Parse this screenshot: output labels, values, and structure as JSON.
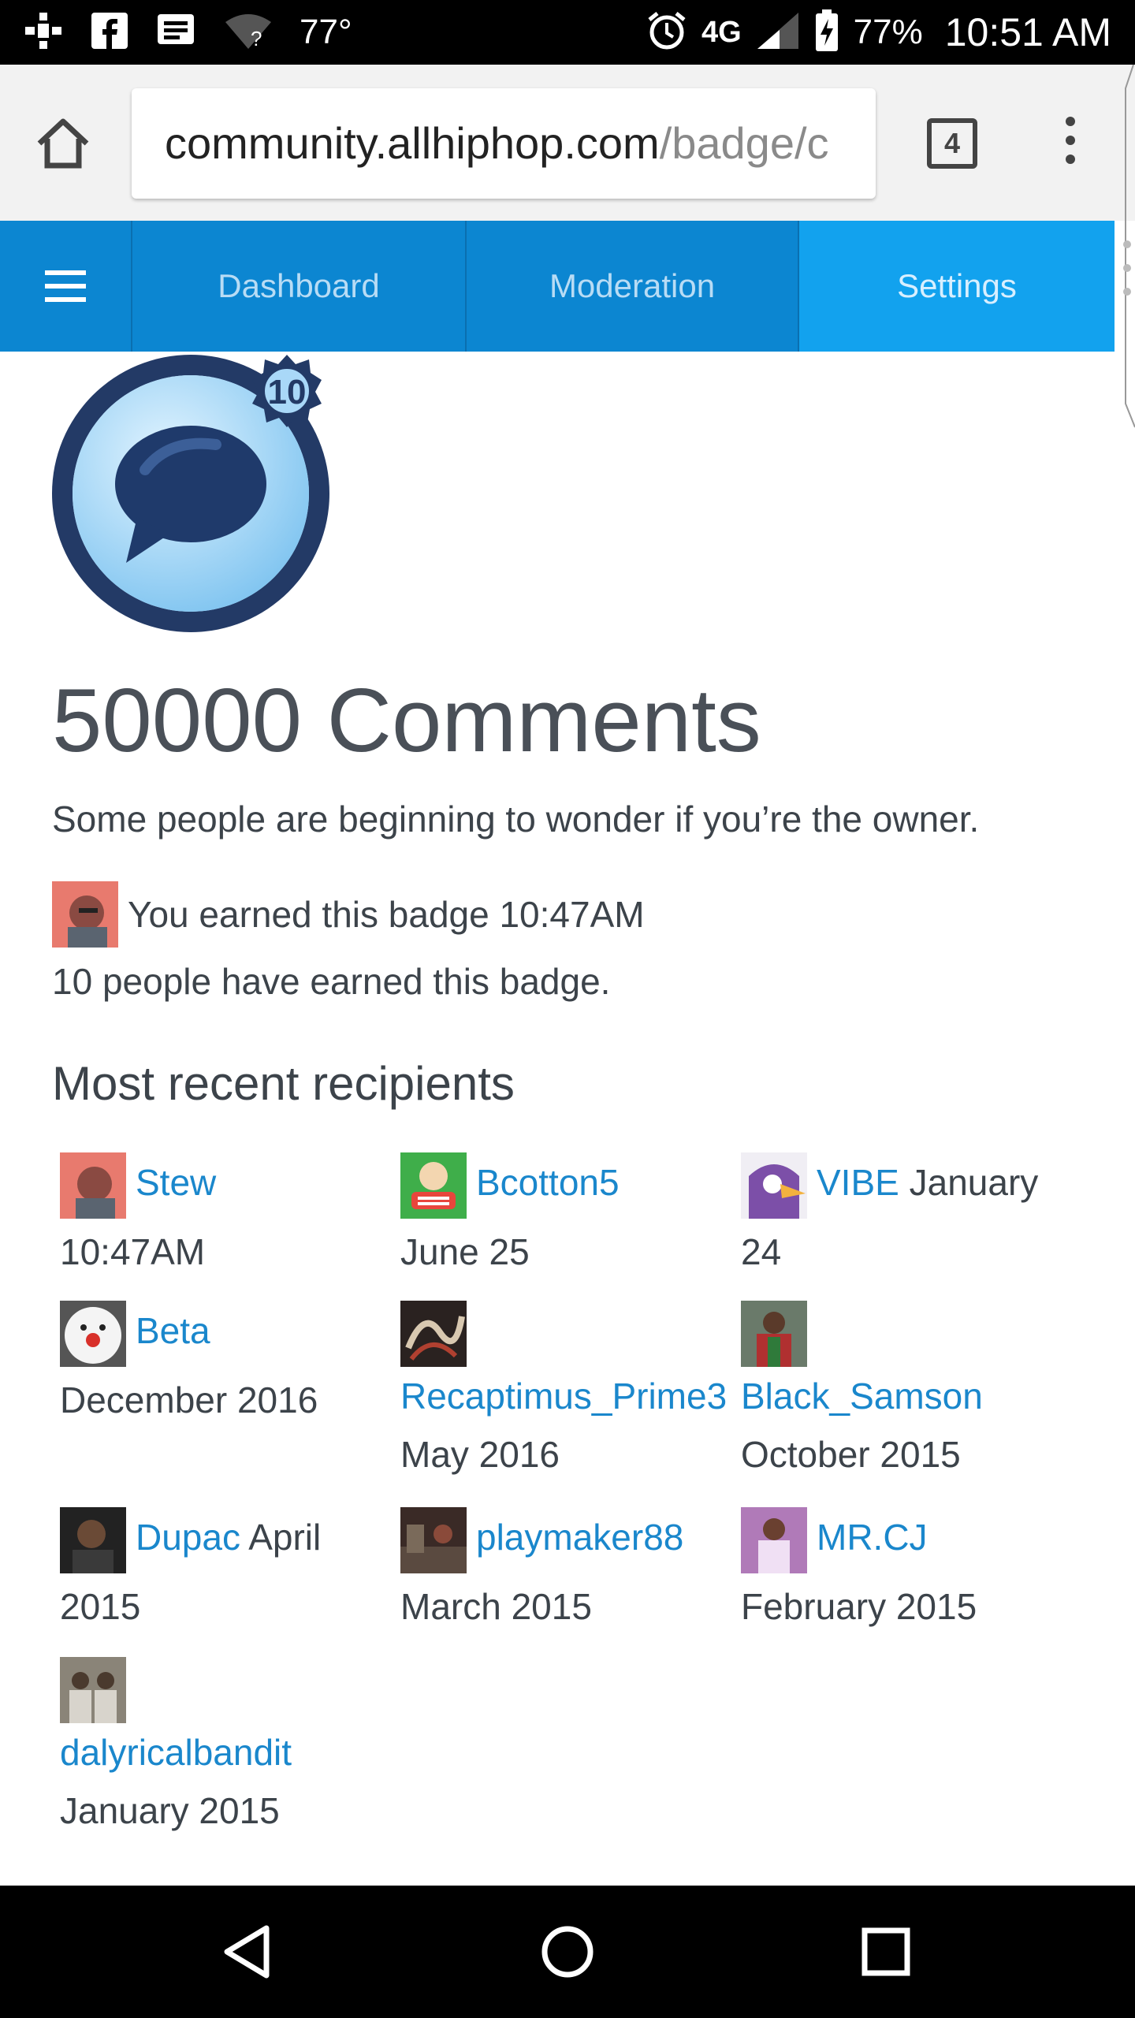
{
  "status_bar": {
    "temperature": "77°",
    "network": "4G",
    "battery": "77%",
    "time": "10:51 AM",
    "icons": [
      "dropbox-icon",
      "facebook-icon",
      "message-icon",
      "wifi-question-icon",
      "alarm-icon",
      "signal-icon",
      "battery-charging-icon"
    ]
  },
  "browser": {
    "url_domain": "community.allhiphop.com",
    "url_path": "/badge/c",
    "tab_count": "4"
  },
  "nav": {
    "tabs": [
      "Dashboard",
      "Moderation",
      "Settings"
    ],
    "active_tab": "Settings"
  },
  "badge": {
    "level": "10",
    "title": "50000 Comments",
    "description": "Some people are beginning to wonder if you’re the owner.",
    "earned_text": "You earned this badge 10:47AM",
    "count_text": "10 people have earned this badge."
  },
  "recent": {
    "heading": "Most recent recipients",
    "items": [
      {
        "name": "Stew",
        "date": "10:47AM"
      },
      {
        "name": "Bcotton5",
        "date": "June 25"
      },
      {
        "name": "VIBE",
        "date": "January 24"
      },
      {
        "name": "Beta",
        "date": "December 2016"
      },
      {
        "name": "Recaptimus_Prime3",
        "date": "May 2016"
      },
      {
        "name": "Black_Samson",
        "date": "October 2015"
      },
      {
        "name": "Dupac",
        "date": "April 2015"
      },
      {
        "name": "playmaker88",
        "date": "March 2015"
      },
      {
        "name": "MR.CJ",
        "date": "February 2015"
      },
      {
        "name": "dalyricalbandit",
        "date": "January 2015"
      }
    ]
  },
  "colors": {
    "link": "#1a87cc",
    "nav_bg": "#0c86d1",
    "nav_active": "#12a2ee",
    "text": "#3c434a"
  }
}
